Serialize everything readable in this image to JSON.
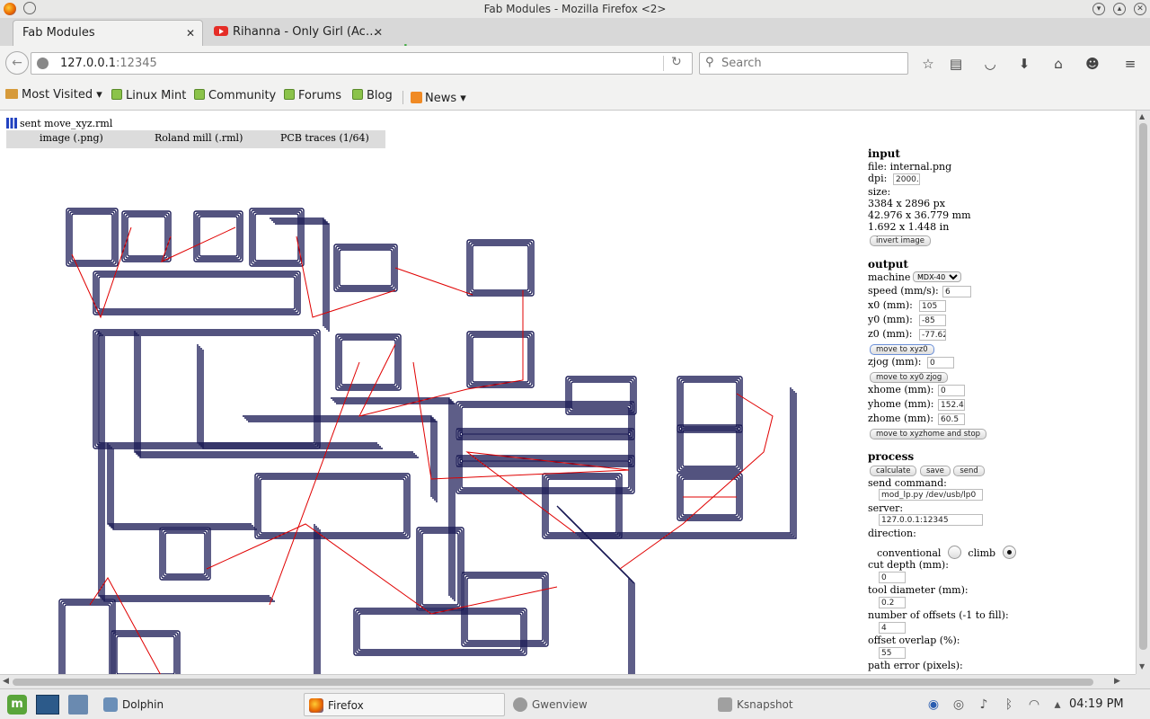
{
  "window": {
    "title": "Fab Modules - Mozilla Firefox <2>"
  },
  "tabs": [
    {
      "label": "Fab Modules",
      "close": "✕"
    },
    {
      "label": "Rihanna - Only Girl (Ac…",
      "close": "✕"
    }
  ],
  "newtab": "+",
  "nav": {
    "url_host": "127.0.0.1",
    "url_port": ":12345",
    "search_placeholder": "Search",
    "reload": "↻",
    "back": "←"
  },
  "bookmarks": [
    {
      "label": "Most Visited",
      "icon": "folder-icon",
      "dropdown": "▾"
    },
    {
      "label": "Linux Mint",
      "icon": "mint-icon"
    },
    {
      "label": "Community",
      "icon": "mint-icon"
    },
    {
      "label": "Forums",
      "icon": "mint-icon"
    },
    {
      "label": "Blog",
      "icon": "mint-icon"
    },
    {
      "label": "News",
      "icon": "rss-icon",
      "dropdown": "▾"
    }
  ],
  "page": {
    "status": "sent move_xyz.rml",
    "menu": [
      "image (.png)",
      "Roland mill (.rml)",
      "PCB traces (1/64)"
    ],
    "input": {
      "heading": "input",
      "file": "file: internal.png",
      "dpi_label": "dpi:",
      "dpi": "2000.0",
      "size_label": "size:",
      "size_px": "3384 x 2896 px",
      "size_mm": "42.976 x 36.779 mm",
      "size_in": "1.692 x 1.448 in",
      "invert_button": "invert image"
    },
    "output": {
      "heading": "output",
      "machine_label": "machine",
      "machine": "MDX-40",
      "speed_label": "speed (mm/s):",
      "speed": "6",
      "x0_label": "x0 (mm):",
      "x0": "105",
      "y0_label": "y0 (mm):",
      "y0": "-85",
      "z0_label": "z0 (mm):",
      "z0": "-77.62",
      "move_xyz0_button": "move to xyz0",
      "zjog_label": "zjog (mm):",
      "zjog": "0",
      "move_xy0_button": "move to xy0 zjog",
      "xhome_label": "xhome (mm):",
      "xhome": "0",
      "yhome_label": "yhome (mm):",
      "yhome": "152.4",
      "zhome_label": "zhome (mm):",
      "zhome": "60.5",
      "move_home_button": "move to xyzhome and stop"
    },
    "process": {
      "heading": "process",
      "calculate_button": "calculate",
      "save_button": "save",
      "send_button": "send",
      "send_command_label": "send command:",
      "send_command": "mod_lp.py /dev/usb/lp0",
      "server_label": "server:",
      "server": "127.0.0.1:12345",
      "direction_label": "direction:",
      "conventional_label": "conventional",
      "climb_label": "climb",
      "direction_selected": "climb",
      "cut_depth_label": "cut depth (mm):",
      "cut_depth": "0",
      "tool_diameter_label": "tool diameter (mm):",
      "tool_diameter": "0.2",
      "offsets_label": "number of offsets (-1 to fill):",
      "offsets": "4",
      "overlap_label": "offset overlap (%):",
      "overlap": "55",
      "path_error_label": "path error (pixels):"
    }
  },
  "taskbar": {
    "items": [
      {
        "label": "Dolphin",
        "active": false
      },
      {
        "label": "Firefox",
        "active": true
      },
      {
        "label": "Gwenview",
        "active": false
      },
      {
        "label": "Ksnapshot",
        "active": false
      }
    ],
    "clock": "04:19 PM"
  },
  "colors": {
    "trace": "#1a1a55",
    "rapid_move": "#e00000",
    "menu_bg": "#dcdcdc",
    "tab_active_bg": "#f2f2f1"
  }
}
